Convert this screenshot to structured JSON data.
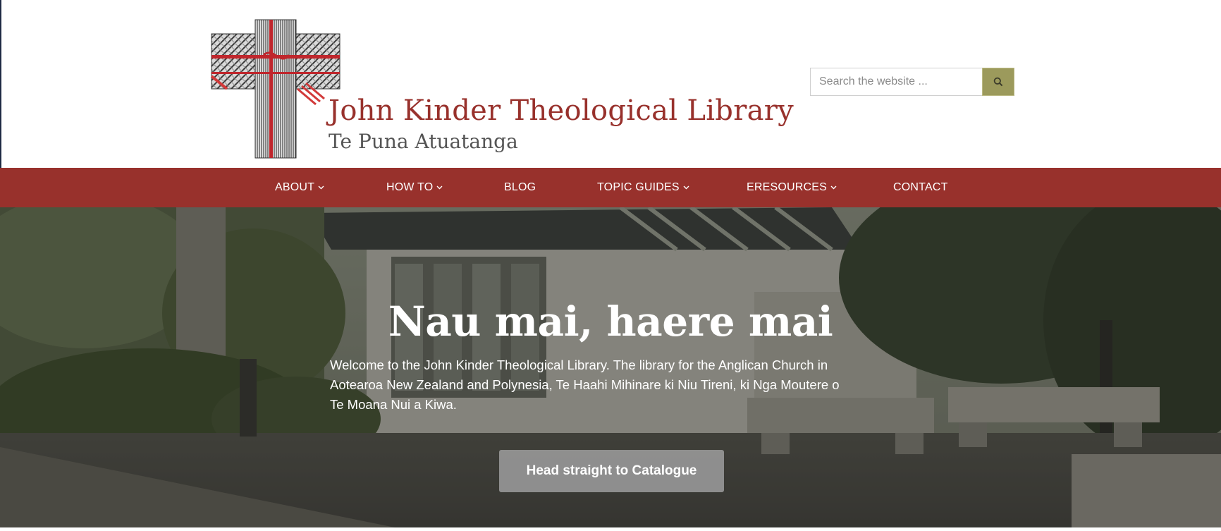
{
  "header": {
    "logo": {
      "title": "John Kinder Theological Library",
      "subtitle": "Te Puna Atuatanga",
      "icon": "woven-cross-logo"
    },
    "search": {
      "placeholder": "Search the website ...",
      "button_icon": "search-icon"
    }
  },
  "nav": {
    "items": [
      {
        "label": "ABOUT",
        "has_dropdown": true
      },
      {
        "label": "HOW TO",
        "has_dropdown": true
      },
      {
        "label": "BLOG",
        "has_dropdown": false
      },
      {
        "label": "TOPIC GUIDES",
        "has_dropdown": true
      },
      {
        "label": "ERESOURCES",
        "has_dropdown": true
      },
      {
        "label": "CONTACT",
        "has_dropdown": false
      }
    ]
  },
  "hero": {
    "title": "Nau mai, haere mai",
    "text": "Welcome to the John Kinder Theological Library. The library for the Anglican Church in Aotearoa New Zealand and Polynesia, Te Haahi Mihinare ki Niu Tireni, ki Nga Moutere o Te Moana Nui a Kiwa.",
    "button_label": "Head straight to Catalogue"
  },
  "colors": {
    "brand_red": "#98312c",
    "search_button": "#9c9a5c",
    "subtitle_grey": "#555555"
  }
}
